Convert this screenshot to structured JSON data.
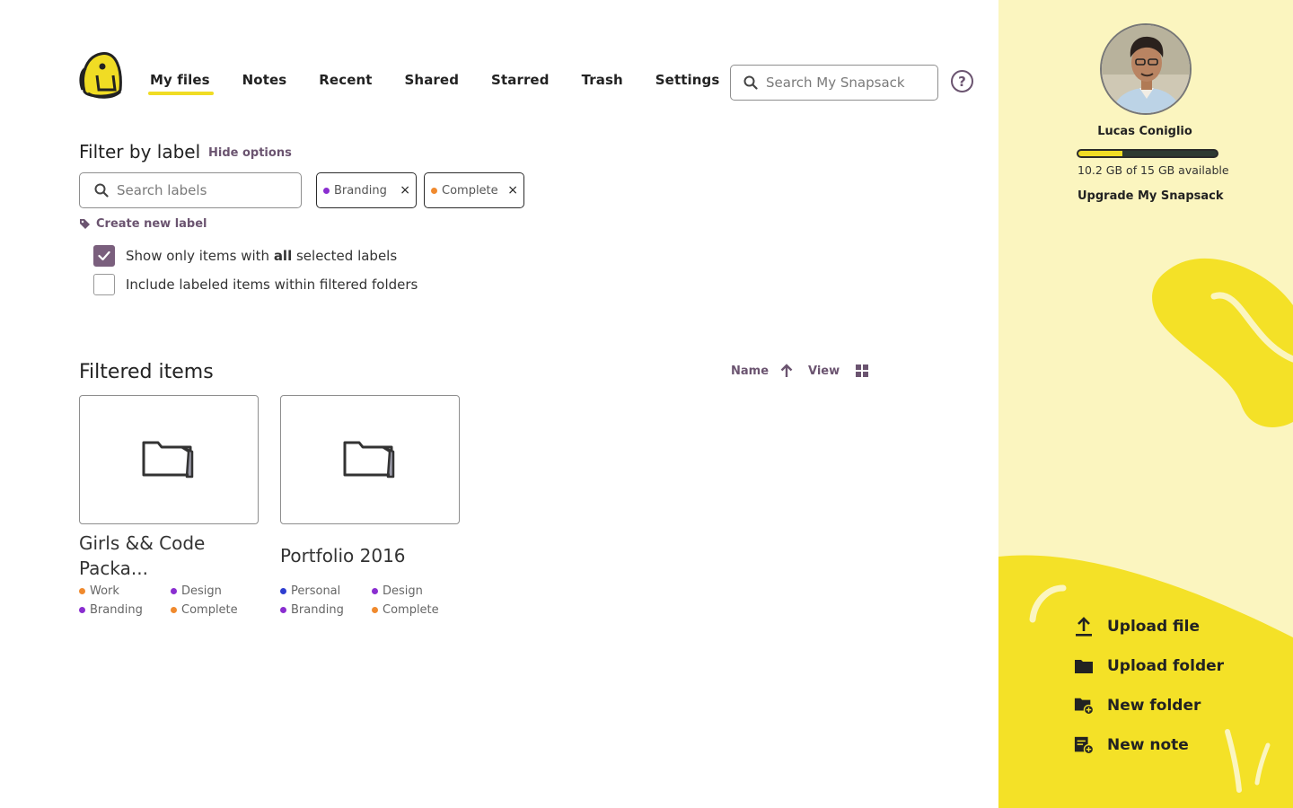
{
  "nav": {
    "items": [
      {
        "label": "My files",
        "active": true
      },
      {
        "label": "Notes"
      },
      {
        "label": "Recent"
      },
      {
        "label": "Shared"
      },
      {
        "label": "Starred"
      },
      {
        "label": "Trash"
      },
      {
        "label": "Settings"
      }
    ],
    "search_placeholder": "Search My Snapsack",
    "help_icon": "?"
  },
  "filter": {
    "title": "Filter by label",
    "hide_options": "Hide options",
    "search_placeholder": "Search labels",
    "chips": [
      {
        "label": "Branding",
        "color": "#8a2ed0"
      },
      {
        "label": "Complete",
        "color": "#f08a2e"
      }
    ],
    "chip_remove": "×",
    "create_label": "Create new label",
    "options": {
      "only_all_prefix": "Show only items with ",
      "only_all_bold": "all",
      "only_all_suffix": " selected labels",
      "only_all_checked": true,
      "include_nested": "Include labeled items within filtered folders",
      "include_nested_checked": false
    }
  },
  "items": {
    "title": "Filtered items",
    "sort_label": "Name",
    "view_label": "View",
    "list": [
      {
        "title": "Girls && Code Packa...",
        "tags": [
          {
            "label": "Work",
            "color": "#f08a2e"
          },
          {
            "label": "Design",
            "color": "#8a2ed0"
          },
          {
            "label": "Branding",
            "color": "#8a2ed0"
          },
          {
            "label": "Complete",
            "color": "#f08a2e"
          }
        ]
      },
      {
        "title": "Portfolio 2016",
        "tags": [
          {
            "label": "Personal",
            "color": "#2e3ed0"
          },
          {
            "label": "Design",
            "color": "#8a2ed0"
          },
          {
            "label": "Branding",
            "color": "#8a2ed0"
          },
          {
            "label": "Complete",
            "color": "#f08a2e"
          }
        ]
      }
    ]
  },
  "sidebar": {
    "user_name": "Lucas Coniglio",
    "storage_used_fraction": 0.32,
    "storage_text": "10.2 GB of 15 GB available",
    "upgrade": "Upgrade My Snapsack",
    "actions": [
      {
        "label": "Upload file",
        "icon": "upload-icon"
      },
      {
        "label": "Upload folder",
        "icon": "folder-icon"
      },
      {
        "label": "New folder",
        "icon": "new-folder-icon"
      },
      {
        "label": "New note",
        "icon": "new-note-icon"
      }
    ]
  },
  "colors": {
    "accent_yellow": "#f0dc24",
    "sidebar_bg": "#fbf5bf",
    "purple_text": "#6b5470"
  }
}
